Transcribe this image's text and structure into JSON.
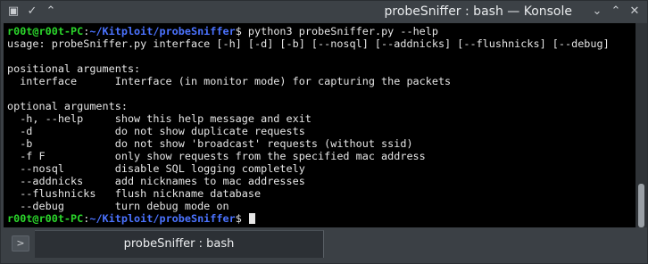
{
  "window": {
    "title": "probeSniffer : bash — Konsole"
  },
  "terminal": {
    "prompt_user": "r00t@r00t-PC",
    "prompt_sep": ":",
    "prompt_path": "~/Kitploit/probeSniffer",
    "prompt_end": "$ ",
    "command": "python3 probeSniffer.py --help",
    "output_lines": [
      "usage: probeSniffer.py interface [-h] [-d] [-b] [--nosql] [--addnicks] [--flushnicks] [--debug]",
      "",
      "positional arguments:",
      "  interface      Interface (in monitor mode) for capturing the packets",
      "",
      "optional arguments:",
      "  -h, --help     show this help message and exit",
      "  -d             do not show duplicate requests",
      "  -b             do not show 'broadcast' requests (without ssid)",
      "  -f F           only show requests from the specified mac address",
      "  --nosql        disable SQL logging completely",
      "  --addnicks     add nicknames to mac addresses",
      "  --flushnicks   flush nickname database",
      "  --debug        turn debug mode on"
    ]
  },
  "tabs": [
    {
      "label": "probeSniffer : bash"
    }
  ],
  "colors": {
    "prompt_user": "#2bd62b",
    "prompt_path": "#4b73ff",
    "text": "#e6e6e6",
    "background": "#000000"
  },
  "icons": {
    "window_menu": "konsole-app-icon",
    "pin": "pin-icon",
    "keep_above": "keep-above-icon",
    "minimize": "minimize-icon",
    "maximize": "maximize-icon",
    "close": "close-icon",
    "new_tab": "new-tab-icon"
  }
}
